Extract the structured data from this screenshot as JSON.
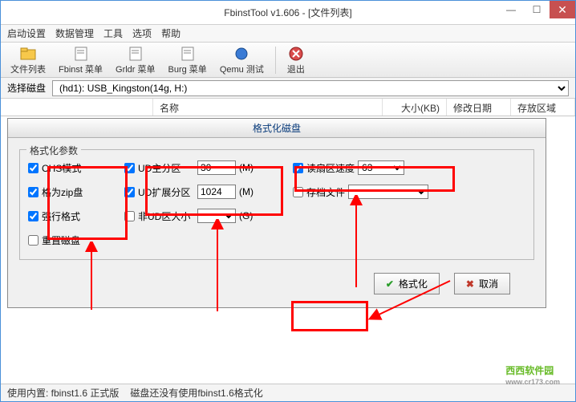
{
  "title": "FbinstTool v1.606 - [文件列表]",
  "winbtns": {
    "min": "—",
    "max": "☐",
    "close": "✕"
  },
  "menu": [
    "启动设置",
    "数据管理",
    "工具",
    "选项",
    "帮助"
  ],
  "toolbar": {
    "items": [
      {
        "label": "文件列表"
      },
      {
        "label": "Fbinst 菜单"
      },
      {
        "label": "Grldr 菜单"
      },
      {
        "label": "Burg 菜单"
      },
      {
        "label": "Qemu 测试"
      }
    ],
    "exit": "退出"
  },
  "disk": {
    "label": "选择磁盘",
    "value": "(hd1): USB_Kingston(14g, H:)"
  },
  "columns": {
    "c1": "",
    "c2": "名称",
    "c3": "大小(KB)",
    "c4": "修改日期",
    "c5": "存放区域"
  },
  "dialog": {
    "title": "格式化磁盘",
    "group": "格式化参数",
    "chs": "CHS模式",
    "zip": "格为zip盘",
    "force": "强行格式",
    "reset": "重置磁盘",
    "udmain": "UD主分区",
    "udmain_val": "30",
    "udext": "UD扩展分区",
    "udext_val": "1024",
    "nonud": "非UD区大小",
    "m": "(M)",
    "g": "(G)",
    "readspeed": "读扇区速度",
    "readspeed_val": "63",
    "archive": "存档文件",
    "btn_format": "格式化",
    "btn_cancel": "取消"
  },
  "status": {
    "left": "使用内置: fbinst1.6 正式版",
    "right": "磁盘还没有使用fbinst1.6格式化"
  },
  "watermark": {
    "main": "西西软件园",
    "sub": "www.cr173.com"
  }
}
